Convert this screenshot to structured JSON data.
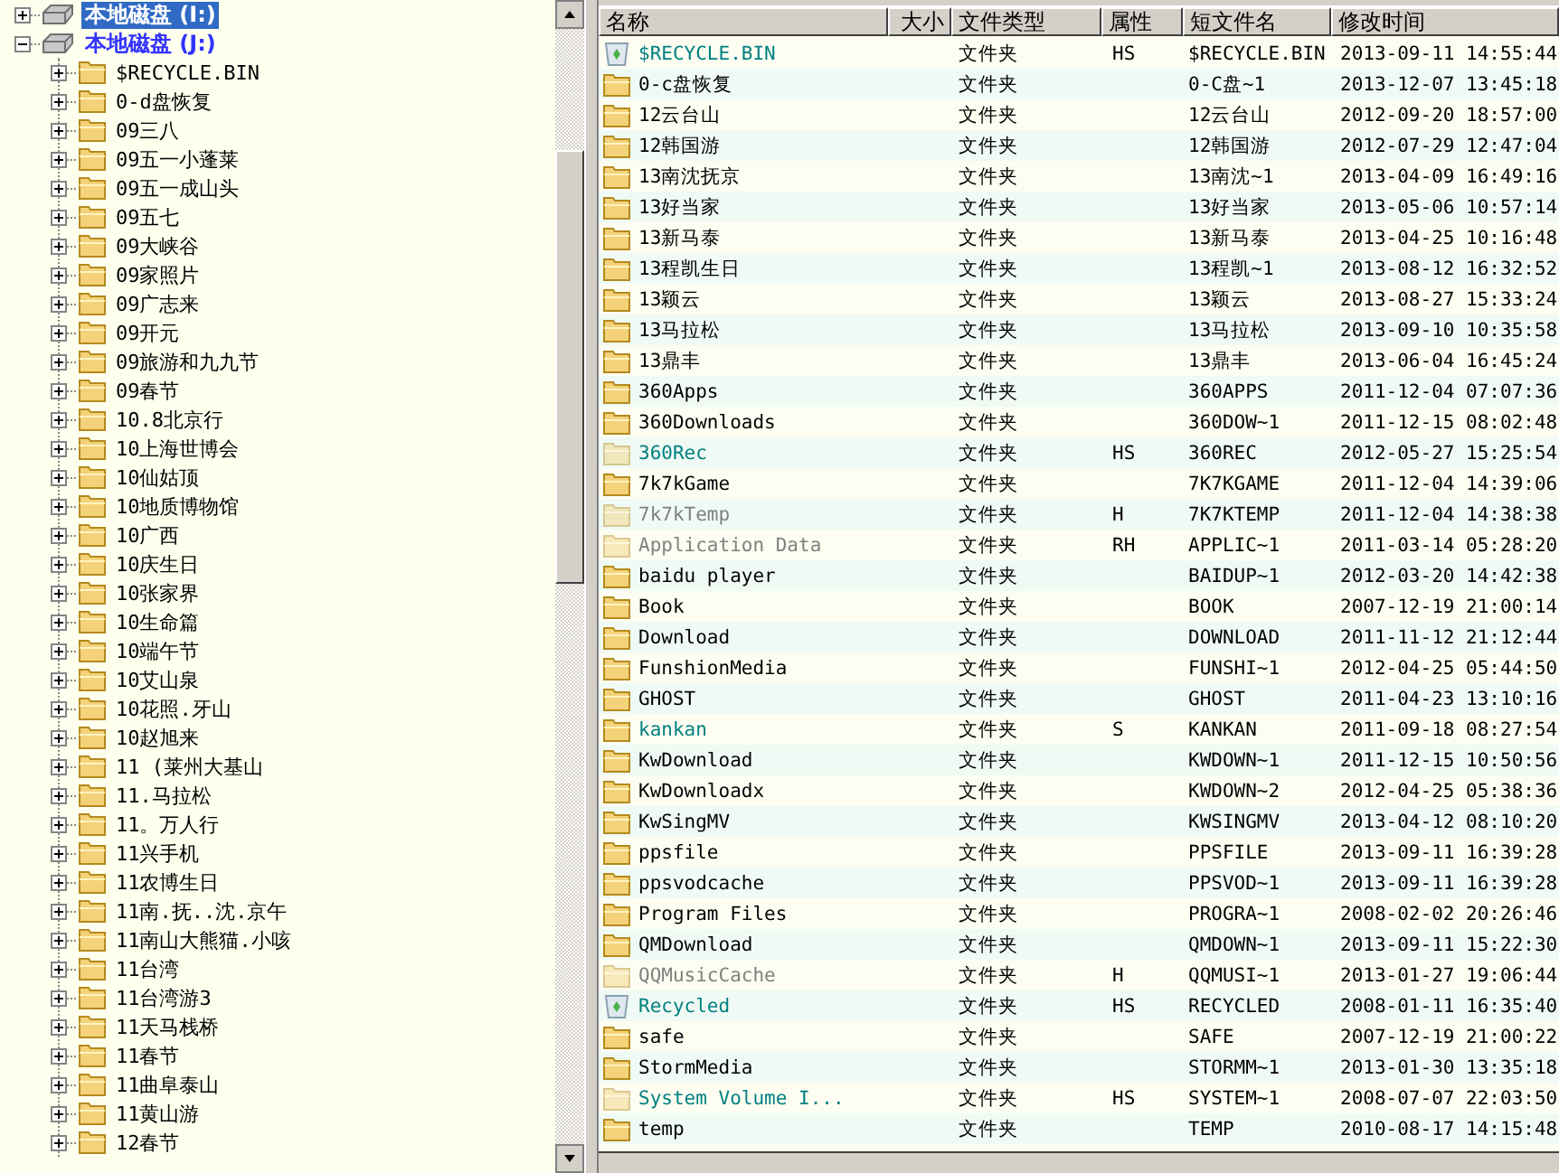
{
  "tree": [
    {
      "label": "本地磁盘 (I:)",
      "kind": "drive",
      "expanded": false,
      "selected": true
    },
    {
      "label": "本地磁盘 (J:)",
      "kind": "drive",
      "expanded": true,
      "selected": false,
      "children": [
        {
          "label": "$RECYCLE.BIN",
          "expanded": false,
          "selected": false
        },
        {
          "label": "0-d盘恢复",
          "expanded": false,
          "selected": false
        },
        {
          "label": "09三八",
          "expanded": false,
          "selected": false
        },
        {
          "label": "09五一小蓬莱",
          "expanded": false,
          "selected": false
        },
        {
          "label": "09五一成山头",
          "expanded": false,
          "selected": false
        },
        {
          "label": "09五七",
          "expanded": false,
          "selected": false
        },
        {
          "label": "09大峡谷",
          "expanded": false,
          "selected": false
        },
        {
          "label": "09家照片",
          "expanded": false,
          "selected": false
        },
        {
          "label": "09广志来",
          "expanded": false,
          "selected": false
        },
        {
          "label": "09开元",
          "expanded": false,
          "selected": false
        },
        {
          "label": "09旅游和九九节",
          "expanded": false,
          "selected": false
        },
        {
          "label": "09春节",
          "expanded": false,
          "selected": false
        },
        {
          "label": "10.8北京行",
          "expanded": false,
          "selected": false
        },
        {
          "label": "10上海世博会",
          "expanded": false,
          "selected": false
        },
        {
          "label": "10仙姑顶",
          "expanded": false,
          "selected": false
        },
        {
          "label": "10地质博物馆",
          "expanded": false,
          "selected": false
        },
        {
          "label": "10广西",
          "expanded": false,
          "selected": false
        },
        {
          "label": "10庆生日",
          "expanded": false,
          "selected": false
        },
        {
          "label": "10张家界",
          "expanded": false,
          "selected": false
        },
        {
          "label": "10生命篇",
          "expanded": false,
          "selected": false
        },
        {
          "label": "10端午节",
          "expanded": false,
          "selected": false
        },
        {
          "label": "10艾山泉",
          "expanded": false,
          "selected": false
        },
        {
          "label": "10花照.牙山",
          "expanded": false,
          "selected": false
        },
        {
          "label": "10赵旭来",
          "expanded": false,
          "selected": false
        },
        {
          "label": "11 (莱州大基山",
          "expanded": false,
          "selected": false
        },
        {
          "label": "11.马拉松",
          "expanded": false,
          "selected": false
        },
        {
          "label": "11。万人行",
          "expanded": false,
          "selected": false
        },
        {
          "label": "11兴手机",
          "expanded": false,
          "selected": false
        },
        {
          "label": "11农博生日",
          "expanded": false,
          "selected": false
        },
        {
          "label": "11南.抚..沈.京午",
          "expanded": false,
          "selected": false
        },
        {
          "label": "11南山大熊猫.小咳",
          "expanded": false,
          "selected": false
        },
        {
          "label": "11台湾",
          "expanded": false,
          "selected": false
        },
        {
          "label": "11台湾游3",
          "expanded": false,
          "selected": false
        },
        {
          "label": "11天马栈桥",
          "expanded": false,
          "selected": false
        },
        {
          "label": "11春节",
          "expanded": false,
          "selected": false
        },
        {
          "label": "11曲阜泰山",
          "expanded": false,
          "selected": false
        },
        {
          "label": "11黄山游",
          "expanded": false,
          "selected": false
        },
        {
          "label": "12春节",
          "expanded": false,
          "selected": false
        }
      ]
    }
  ],
  "table": {
    "columns": [
      "名称",
      "大小",
      "文件类型",
      "属性",
      "短文件名",
      "修改时间"
    ],
    "rows": [
      {
        "kind": "recycle-bin",
        "hidden": false,
        "color": "#008080",
        "name": "$RECYCLE.BIN",
        "type": "文件夹",
        "attributes": "HS",
        "short_name": "$RECYCLE.BIN",
        "modified": "2013-09-11 14:55:44"
      },
      {
        "kind": "folder",
        "hidden": false,
        "color": "#000000",
        "name": "0-c盘恢复",
        "type": "文件夹",
        "short_name": "0-C盘~1",
        "modified": "2013-12-07 13:45:18"
      },
      {
        "kind": "folder",
        "hidden": false,
        "color": "#000000",
        "name": "12云台山",
        "type": "文件夹",
        "short_name": "12云台山",
        "modified": "2012-09-20 18:57:00"
      },
      {
        "kind": "folder",
        "hidden": false,
        "color": "#000000",
        "name": "12韩国游",
        "type": "文件夹",
        "short_name": "12韩国游",
        "modified": "2012-07-29 12:47:04"
      },
      {
        "kind": "folder",
        "hidden": false,
        "color": "#000000",
        "name": "13南沈抚京",
        "type": "文件夹",
        "short_name": "13南沈~1",
        "modified": "2013-04-09 16:49:16"
      },
      {
        "kind": "folder",
        "hidden": false,
        "color": "#000000",
        "name": "13好当家",
        "type": "文件夹",
        "short_name": "13好当家",
        "modified": "2013-05-06 10:57:14"
      },
      {
        "kind": "folder",
        "hidden": false,
        "color": "#000000",
        "name": "13新马泰",
        "type": "文件夹",
        "short_name": "13新马泰",
        "modified": "2013-04-25 10:16:48"
      },
      {
        "kind": "folder",
        "hidden": false,
        "color": "#000000",
        "name": "13程凯生日",
        "type": "文件夹",
        "short_name": "13程凯~1",
        "modified": "2013-08-12 16:32:52"
      },
      {
        "kind": "folder",
        "hidden": false,
        "color": "#000000",
        "name": "13颖云",
        "type": "文件夹",
        "short_name": "13颖云",
        "modified": "2013-08-27 15:33:24"
      },
      {
        "kind": "folder",
        "hidden": false,
        "color": "#000000",
        "name": "13马拉松",
        "type": "文件夹",
        "short_name": "13马拉松",
        "modified": "2013-09-10 10:35:58"
      },
      {
        "kind": "folder",
        "hidden": false,
        "color": "#000000",
        "name": "13鼎丰",
        "type": "文件夹",
        "short_name": "13鼎丰",
        "modified": "2013-06-04 16:45:24"
      },
      {
        "kind": "folder",
        "hidden": false,
        "color": "#000000",
        "name": "360Apps",
        "type": "文件夹",
        "short_name": "360APPS",
        "modified": "2011-12-04 07:07:36"
      },
      {
        "kind": "folder",
        "hidden": false,
        "color": "#000000",
        "name": "360Downloads",
        "type": "文件夹",
        "short_name": "360DOW~1",
        "modified": "2011-12-15 08:02:48"
      },
      {
        "kind": "folder",
        "hidden": true,
        "color": "#008080",
        "name": "360Rec",
        "type": "文件夹",
        "attributes": "HS",
        "short_name": "360REC",
        "modified": "2012-05-27 15:25:54"
      },
      {
        "kind": "folder",
        "hidden": false,
        "color": "#000000",
        "name": "7k7kGame",
        "type": "文件夹",
        "short_name": "7K7KGAME",
        "modified": "2011-12-04 14:39:06"
      },
      {
        "kind": "folder",
        "hidden": true,
        "color": "#808080",
        "name": "7k7kTemp",
        "type": "文件夹",
        "attributes": "H",
        "short_name": "7K7KTEMP",
        "modified": "2011-12-04 14:38:38"
      },
      {
        "kind": "folder",
        "hidden": true,
        "color": "#808080",
        "name": "Application Data",
        "type": "文件夹",
        "attributes": "RH",
        "short_name": "APPLIC~1",
        "modified": "2011-03-14 05:28:20"
      },
      {
        "kind": "folder",
        "hidden": false,
        "color": "#000000",
        "name": "baidu player",
        "type": "文件夹",
        "short_name": "BAIDUP~1",
        "modified": "2012-03-20 14:42:38"
      },
      {
        "kind": "folder",
        "hidden": false,
        "color": "#000000",
        "name": "Book",
        "type": "文件夹",
        "short_name": "BOOK",
        "modified": "2007-12-19 21:00:14"
      },
      {
        "kind": "folder",
        "hidden": false,
        "color": "#000000",
        "name": "Download",
        "type": "文件夹",
        "short_name": "DOWNLOAD",
        "modified": "2011-11-12 21:12:44"
      },
      {
        "kind": "folder",
        "hidden": false,
        "color": "#000000",
        "name": "FunshionMedia",
        "type": "文件夹",
        "short_name": "FUNSHI~1",
        "modified": "2012-04-25 05:44:50"
      },
      {
        "kind": "folder",
        "hidden": false,
        "color": "#000000",
        "name": "GHOST",
        "type": "文件夹",
        "short_name": "GHOST",
        "modified": "2011-04-23 13:10:16"
      },
      {
        "kind": "folder",
        "hidden": false,
        "color": "#008080",
        "name": "kankan",
        "type": "文件夹",
        "attributes": "S",
        "short_name": "KANKAN",
        "modified": "2011-09-18 08:27:54"
      },
      {
        "kind": "folder",
        "hidden": false,
        "color": "#000000",
        "name": "KwDownload",
        "type": "文件夹",
        "short_name": "KWDOWN~1",
        "modified": "2011-12-15 10:50:56"
      },
      {
        "kind": "folder",
        "hidden": false,
        "color": "#000000",
        "name": "KwDownloadx",
        "type": "文件夹",
        "short_name": "KWDOWN~2",
        "modified": "2012-04-25 05:38:36"
      },
      {
        "kind": "folder",
        "hidden": false,
        "color": "#000000",
        "name": "KwSingMV",
        "type": "文件夹",
        "short_name": "KWSINGMV",
        "modified": "2013-04-12 08:10:20"
      },
      {
        "kind": "folder",
        "hidden": false,
        "color": "#000000",
        "name": "ppsfile",
        "type": "文件夹",
        "short_name": "PPSFILE",
        "modified": "2013-09-11 16:39:28"
      },
      {
        "kind": "folder",
        "hidden": false,
        "color": "#000000",
        "name": "ppsvodcache",
        "type": "文件夹",
        "short_name": "PPSVOD~1",
        "modified": "2013-09-11 16:39:28"
      },
      {
        "kind": "folder",
        "hidden": false,
        "color": "#000000",
        "name": "Program Files",
        "type": "文件夹",
        "short_name": "PROGRA~1",
        "modified": "2008-02-02 20:26:46"
      },
      {
        "kind": "folder",
        "hidden": false,
        "color": "#000000",
        "name": "QMDownload",
        "type": "文件夹",
        "short_name": "QMDOWN~1",
        "modified": "2013-09-11 15:22:30"
      },
      {
        "kind": "folder",
        "hidden": true,
        "color": "#808080",
        "name": "QQMusicCache",
        "type": "文件夹",
        "attributes": "H",
        "short_name": "QQMUSI~1",
        "modified": "2013-01-27 19:06:44"
      },
      {
        "kind": "recycle-bin",
        "hidden": false,
        "color": "#008080",
        "name": "Recycled",
        "type": "文件夹",
        "attributes": "HS",
        "short_name": "RECYCLED",
        "modified": "2008-01-11 16:35:40"
      },
      {
        "kind": "folder",
        "hidden": false,
        "color": "#000000",
        "name": "safe",
        "type": "文件夹",
        "short_name": "SAFE",
        "modified": "2007-12-19 21:00:22"
      },
      {
        "kind": "folder",
        "hidden": false,
        "color": "#000000",
        "name": "StormMedia",
        "type": "文件夹",
        "short_name": "STORMM~1",
        "modified": "2013-01-30 13:35:18"
      },
      {
        "kind": "folder",
        "hidden": true,
        "color": "#008080",
        "name": "System Volume I...",
        "type": "文件夹",
        "attributes": "HS",
        "short_name": "SYSTEM~1",
        "modified": "2008-07-07 22:03:50"
      },
      {
        "kind": "folder",
        "hidden": false,
        "color": "#000000",
        "name": "temp",
        "type": "文件夹",
        "short_name": "TEMP",
        "modified": "2010-08-17 14:15:48"
      }
    ]
  }
}
